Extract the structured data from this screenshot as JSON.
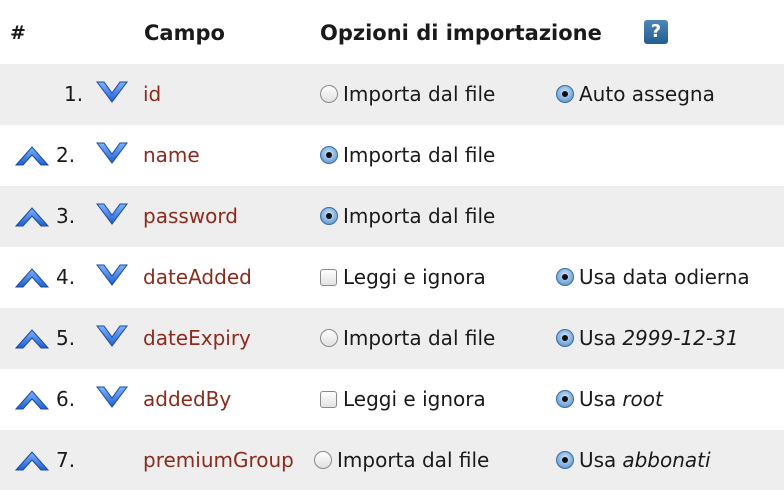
{
  "header": {
    "hash": "#",
    "campo": "Campo",
    "opzioni": "Opzioni di importazione",
    "help": "?"
  },
  "rows": [
    {
      "num": "1.",
      "field": "id",
      "opt1": {
        "label": "Importa dal file",
        "control": "radio",
        "selected": false
      },
      "opt2": {
        "label": "Auto assegna",
        "value": "",
        "selected": true
      }
    },
    {
      "num": "2.",
      "field": "name",
      "opt1": {
        "label": "Importa dal file",
        "control": "radio",
        "selected": true
      }
    },
    {
      "num": "3.",
      "field": "password",
      "opt1": {
        "label": "Importa dal file",
        "control": "radio",
        "selected": true
      }
    },
    {
      "num": "4.",
      "field": "dateAdded",
      "opt1": {
        "label": "Leggi e ignora",
        "control": "checkbox",
        "selected": false
      },
      "opt2": {
        "label": "Usa data odierna",
        "value": "",
        "selected": true
      }
    },
    {
      "num": "5.",
      "field": "dateExpiry",
      "opt1": {
        "label": "Importa dal file",
        "control": "radio",
        "selected": false
      },
      "opt2": {
        "label": "Usa",
        "value": "2999-12-31",
        "selected": true
      }
    },
    {
      "num": "6.",
      "field": "addedBy",
      "opt1": {
        "label": "Leggi e ignora",
        "control": "checkbox",
        "selected": false
      },
      "opt2": {
        "label": "Usa",
        "value": "root",
        "selected": true
      }
    },
    {
      "num": "7.",
      "field": "premiumGroup",
      "opt1": {
        "label": "Importa dal file",
        "control": "radio",
        "selected": false
      },
      "opt2": {
        "label": "Usa",
        "value": "abbonati",
        "selected": true
      }
    }
  ],
  "colors": {
    "field_text": "#8b2b1e",
    "arrow_blue": "#2f6fd0",
    "row_shade": "#eeeeee",
    "help_bg": "#2f6a9c"
  },
  "icons": {
    "up": "chevron-up-icon",
    "down": "chevron-down-icon",
    "help": "help-icon"
  }
}
